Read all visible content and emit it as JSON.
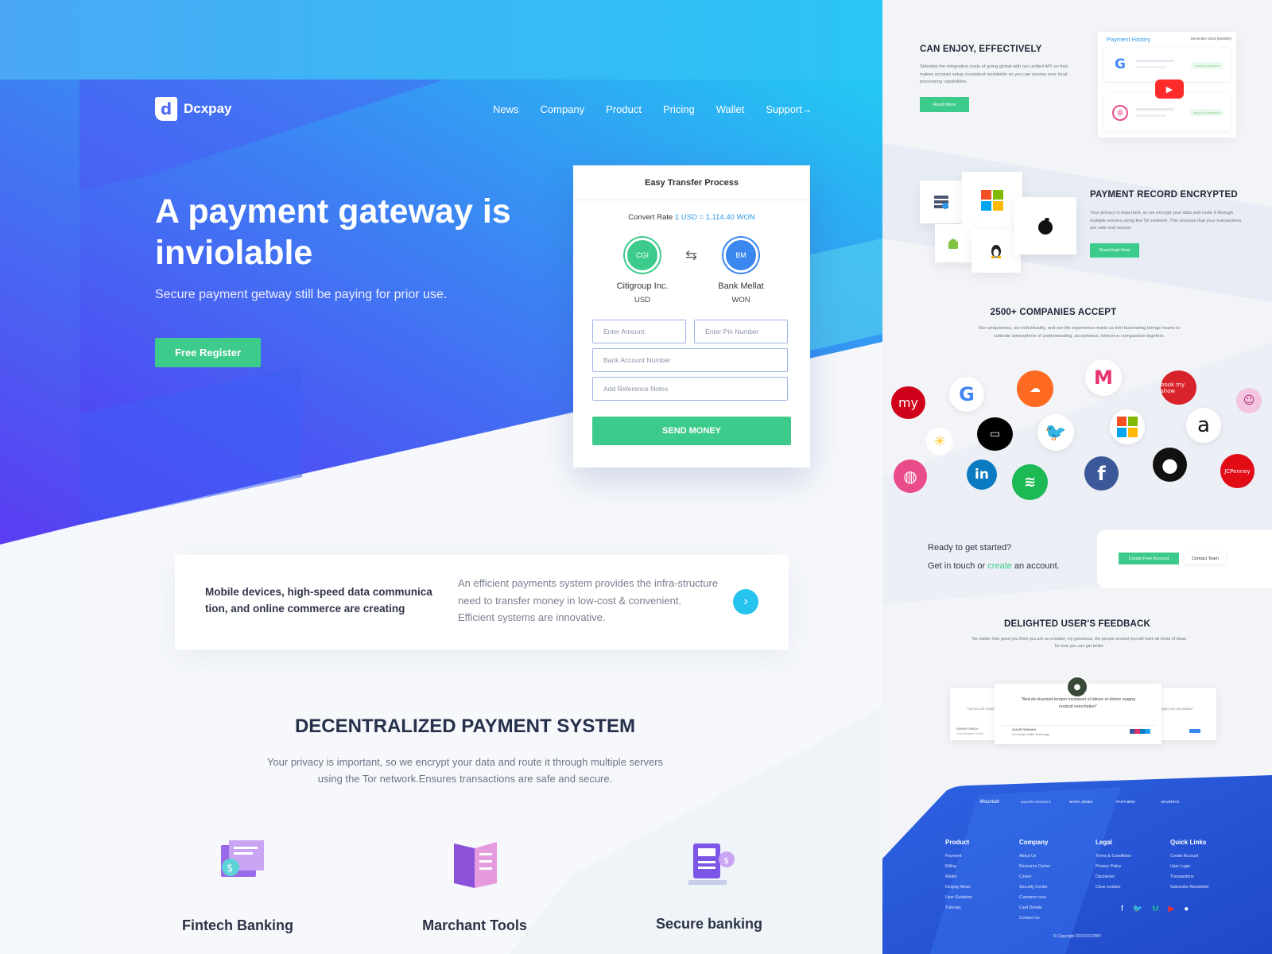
{
  "brand": {
    "name": "Dcxpay",
    "mark": "d"
  },
  "nav": [
    "News",
    "Company",
    "Product",
    "Pricing",
    "Wallet",
    "Support→"
  ],
  "hero": {
    "title": "A payment gateway is inviolable",
    "subtitle": "Secure payment getway still be paying for prior use.",
    "cta": "Free Register"
  },
  "transfer": {
    "title": "Easy Transfer Process",
    "rate_label": "Convert Rate",
    "rate_value": "1 USD = 1,114.40 WON",
    "from": {
      "initials": "CGI",
      "name": "Citigroup Inc.",
      "currency": "USD",
      "color": "#3dcb8b"
    },
    "to": {
      "initials": "BM",
      "name": "Bank Mellat",
      "currency": "WON",
      "color": "#3b87f0"
    },
    "amount_ph": "Enter Amount",
    "pin_ph": "Enter Pin Number",
    "account_ph": "Bank Account Number",
    "notes_ph": "Add Reference Notes",
    "send": "SEND MONEY"
  },
  "strip": {
    "left": "Mobile devices, high-speed data communica tion, and online commerce are creating",
    "right": "An efficient payments system provides the infra-structure need to transfer money in low-cost & convenient. Efficient systems are innovative."
  },
  "decentral": {
    "title": "DECENTRALIZED PAYMENT SYSTEM",
    "desc1": "Your privacy is important, so we encrypt your data and route it through multiple servers",
    "desc2": "using the Tor network.Ensures transactions are safe and secure."
  },
  "features": [
    "Fintech Banking",
    "Marchant Tools",
    "Secure banking"
  ],
  "right": {
    "enjoy": {
      "title": "CAN ENJOY, EFFECTIVELY",
      "text": "Sidestep the integration costs of going global with our unified API on that makes account setup consistent worldwide so you can access over local processing capabilities.",
      "btn": "Read More"
    },
    "history": {
      "title": "Payment History",
      "date": "December 2018 (transfer)",
      "pending": "pending payment",
      "approved": "approved payment"
    },
    "encrypted": {
      "title": "PAYMENT RECORD ENCRYPTED",
      "text": "Your privacy is important, so we encrypt your data and route it through multiple servers using the Tor network. This ensures that your transactions are safe and secure.",
      "btn": "Download Now"
    },
    "companies": {
      "title": "2500+ COMPANIES ACCEPT",
      "text": "Our uniqueness, our individuality, and our life experience molds us into fascinating beings hearts to cultivate atmosphere of understanding, acceptance, tolerance compassion together."
    },
    "logos": {
      "my": "my",
      "booking": "book my show",
      "jcp": "JCPenney",
      "amazon": "a",
      "fb": "f",
      "in": "in"
    },
    "cta": {
      "l1": "Ready to get started?",
      "l2a": "Get in touch or ",
      "l2b": "create",
      "l2c": " an account.",
      "btn1": "Create Free Account",
      "btn2": "Contact Team"
    },
    "feedback": {
      "title": "DELIGHTED USER'S FEEDBACK",
      "text": "No matter how good you think you are as a leader, my goodness, the people around you will have all kinds of ideas for how you can get better",
      "quote": "\"Aed do eiusmod tempor incididunt ut labore et dolore magna nostrud exercitation\"",
      "name": "ATAUR RAHMAN",
      "role": "Co-founder, Delite Technology",
      "side_l": "\"Aed do eiu nostrud e",
      "side_r": "magna nos xercitation\"",
      "side_name": "SAHIER SINGH",
      "side_role": "Lead Designer, Xfeba"
    },
    "badges": [
      "Mountain",
      "MILLERS RESORTS",
      "MARK JONES",
      "PANTHERS",
      "MAVERICK"
    ],
    "footer": {
      "product": {
        "h": "Product",
        "items": [
          "Payment",
          "Billing",
          "Wallet",
          "Dcxpay News",
          "User Guideline",
          "Tutorials"
        ]
      },
      "company": {
        "h": "Company",
        "items": [
          "About Us",
          "Resource Center",
          "Career",
          "Security Center",
          "Customer care",
          "Card Details",
          "Contact Us"
        ]
      },
      "legal": {
        "h": "Legal",
        "items": [
          "Terms & Conditions",
          "Privacy Policy",
          "Disclaimer",
          "Clear cookies"
        ]
      },
      "quick": {
        "h": "Quick Links",
        "items": [
          "Create Account",
          "User Login",
          "Transactions",
          "Subscribe Newsletter"
        ]
      },
      "copyright": "© Copyright 2019 DCXPAY"
    }
  }
}
